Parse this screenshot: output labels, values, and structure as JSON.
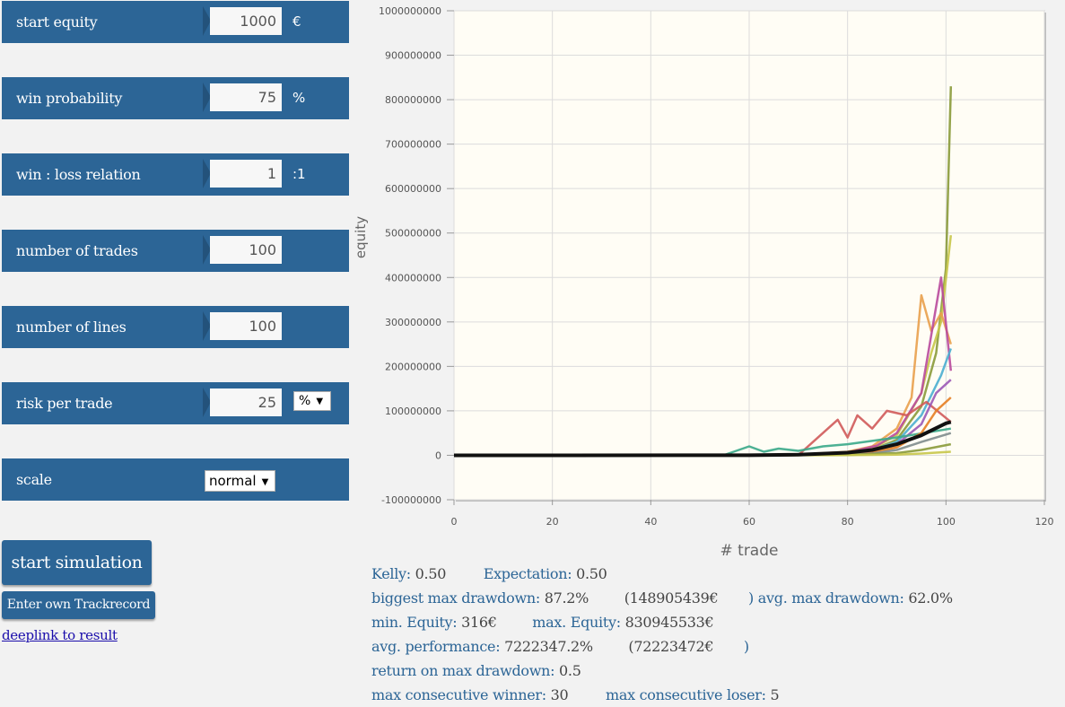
{
  "params": {
    "start_equity": {
      "label": "start equity",
      "value": "1000",
      "unit": "€"
    },
    "win_probability": {
      "label": "win probability",
      "value": "75",
      "unit": "%"
    },
    "win_loss": {
      "label": "win : loss relation",
      "value": "1",
      "unit": ":1"
    },
    "num_trades": {
      "label": "number of trades",
      "value": "100"
    },
    "num_lines": {
      "label": "number of lines",
      "value": "100"
    },
    "risk": {
      "label": "risk per trade",
      "value": "25",
      "unit_select": "%"
    },
    "scale": {
      "label": "scale",
      "selected": "normal"
    }
  },
  "buttons": {
    "start": "start simulation",
    "trackrecord": "Enter own Trackrecord",
    "deeplink": "deeplink to result"
  },
  "stats": {
    "kelly_label": "Kelly:",
    "kelly_value": "0.50",
    "expectation_label": "Expectation:",
    "expectation_value": "0.50",
    "biggest_dd_label": "biggest max drawdown:",
    "biggest_dd_value": "87.2%",
    "biggest_dd_abs": "(148905439€",
    "biggest_dd_close": ")",
    "avg_dd_label": "avg. max drawdown:",
    "avg_dd_value": "62.0%",
    "min_eq_label": "min. Equity:",
    "min_eq_value": "316€",
    "max_eq_label": "max. Equity:",
    "max_eq_value": "830945533€",
    "avg_perf_label": "avg. performance:",
    "avg_perf_value": "7222347.2%",
    "avg_perf_abs": "(72223472€",
    "avg_perf_close": ")",
    "romd_label": "return on max drawdown:",
    "romd_value": "0.5",
    "max_win_label": "max consecutive winner:",
    "max_win_value": "30",
    "max_loss_label": "max consecutive loser:",
    "max_loss_value": "5"
  },
  "colors": {
    "panel": "#2c6596",
    "plot_bg": "#fffdf5",
    "series": [
      "#8a9a3a",
      "#c8c74a",
      "#e9a04c",
      "#b94a9c",
      "#4aaed0",
      "#d05a5a",
      "#9b59b6",
      "#3aa88a",
      "#e67e22",
      "#7f8c8d"
    ],
    "mean_line": "#111111"
  },
  "chart_data": {
    "type": "line",
    "xlabel": "# trade",
    "ylabel": "equity",
    "xlim": [
      0,
      120
    ],
    "ylim": [
      -100000000,
      1000000000
    ],
    "xticks": [
      0,
      20,
      40,
      60,
      80,
      100,
      120
    ],
    "yticks": [
      -100000000,
      0,
      100000000,
      200000000,
      300000000,
      400000000,
      500000000,
      600000000,
      700000000,
      800000000,
      900000000,
      1000000000
    ],
    "grid": true,
    "series": [
      {
        "values": [
          [
            0,
            0
          ],
          [
            60,
            0
          ],
          [
            70,
            1000000
          ],
          [
            80,
            5000000
          ],
          [
            85,
            12000000
          ],
          [
            90,
            35000000
          ],
          [
            95,
            110000000
          ],
          [
            98,
            230000000
          ],
          [
            100,
            420000000
          ],
          [
            101,
            830000000
          ]
        ]
      },
      {
        "values": [
          [
            0,
            0
          ],
          [
            60,
            0
          ],
          [
            70,
            1000000
          ],
          [
            80,
            6000000
          ],
          [
            85,
            15000000
          ],
          [
            90,
            45000000
          ],
          [
            95,
            140000000
          ],
          [
            97,
            230000000
          ],
          [
            99,
            300000000
          ],
          [
            101,
            495000000
          ]
        ]
      },
      {
        "values": [
          [
            0,
            0
          ],
          [
            60,
            0
          ],
          [
            70,
            1500000
          ],
          [
            80,
            8000000
          ],
          [
            85,
            20000000
          ],
          [
            90,
            60000000
          ],
          [
            93,
            130000000
          ],
          [
            95,
            360000000
          ],
          [
            97,
            280000000
          ],
          [
            99,
            320000000
          ],
          [
            101,
            250000000
          ]
        ]
      },
      {
        "values": [
          [
            0,
            0
          ],
          [
            60,
            0
          ],
          [
            70,
            1000000
          ],
          [
            80,
            6000000
          ],
          [
            86,
            22000000
          ],
          [
            90,
            50000000
          ],
          [
            95,
            140000000
          ],
          [
            99,
            400000000
          ],
          [
            101,
            190000000
          ]
        ]
      },
      {
        "values": [
          [
            0,
            0
          ],
          [
            60,
            0
          ],
          [
            70,
            800000
          ],
          [
            80,
            5000000
          ],
          [
            85,
            12000000
          ],
          [
            90,
            30000000
          ],
          [
            95,
            90000000
          ],
          [
            99,
            180000000
          ],
          [
            101,
            240000000
          ]
        ]
      },
      {
        "values": [
          [
            0,
            0
          ],
          [
            60,
            0
          ],
          [
            70,
            500000
          ],
          [
            78,
            80000000
          ],
          [
            80,
            40000000
          ],
          [
            82,
            90000000
          ],
          [
            85,
            60000000
          ],
          [
            88,
            100000000
          ],
          [
            92,
            90000000
          ],
          [
            96,
            120000000
          ],
          [
            101,
            75000000
          ]
        ]
      },
      {
        "values": [
          [
            0,
            0
          ],
          [
            60,
            0
          ],
          [
            70,
            600000
          ],
          [
            80,
            3000000
          ],
          [
            85,
            9000000
          ],
          [
            90,
            25000000
          ],
          [
            95,
            70000000
          ],
          [
            98,
            140000000
          ],
          [
            101,
            170000000
          ]
        ]
      },
      {
        "values": [
          [
            0,
            0
          ],
          [
            55,
            1000000
          ],
          [
            60,
            20000000
          ],
          [
            63,
            8000000
          ],
          [
            66,
            15000000
          ],
          [
            70,
            10000000
          ],
          [
            75,
            20000000
          ],
          [
            80,
            25000000
          ],
          [
            90,
            40000000
          ],
          [
            101,
            60000000
          ]
        ]
      },
      {
        "values": [
          [
            0,
            0
          ],
          [
            60,
            0
          ],
          [
            70,
            400000
          ],
          [
            80,
            2000000
          ],
          [
            85,
            6000000
          ],
          [
            90,
            18000000
          ],
          [
            95,
            50000000
          ],
          [
            98,
            100000000
          ],
          [
            101,
            130000000
          ]
        ]
      },
      {
        "values": [
          [
            0,
            0
          ],
          [
            60,
            0
          ],
          [
            70,
            300000
          ],
          [
            80,
            1500000
          ],
          [
            85,
            4000000
          ],
          [
            90,
            12000000
          ],
          [
            95,
            30000000
          ],
          [
            101,
            50000000
          ]
        ]
      },
      {
        "values": [
          [
            0,
            0
          ],
          [
            60,
            0
          ],
          [
            80,
            800000
          ],
          [
            90,
            5000000
          ],
          [
            95,
            12000000
          ],
          [
            101,
            25000000
          ]
        ]
      },
      {
        "values": [
          [
            0,
            0
          ],
          [
            60,
            0
          ],
          [
            80,
            300000
          ],
          [
            90,
            1500000
          ],
          [
            95,
            4000000
          ],
          [
            101,
            8000000
          ]
        ]
      }
    ],
    "mean_series": {
      "values": [
        [
          0,
          0
        ],
        [
          60,
          200000
        ],
        [
          70,
          1500000
        ],
        [
          80,
          6000000
        ],
        [
          85,
          12000000
        ],
        [
          90,
          25000000
        ],
        [
          95,
          45000000
        ],
        [
          100,
          72000000
        ],
        [
          101,
          75000000
        ]
      ]
    }
  }
}
